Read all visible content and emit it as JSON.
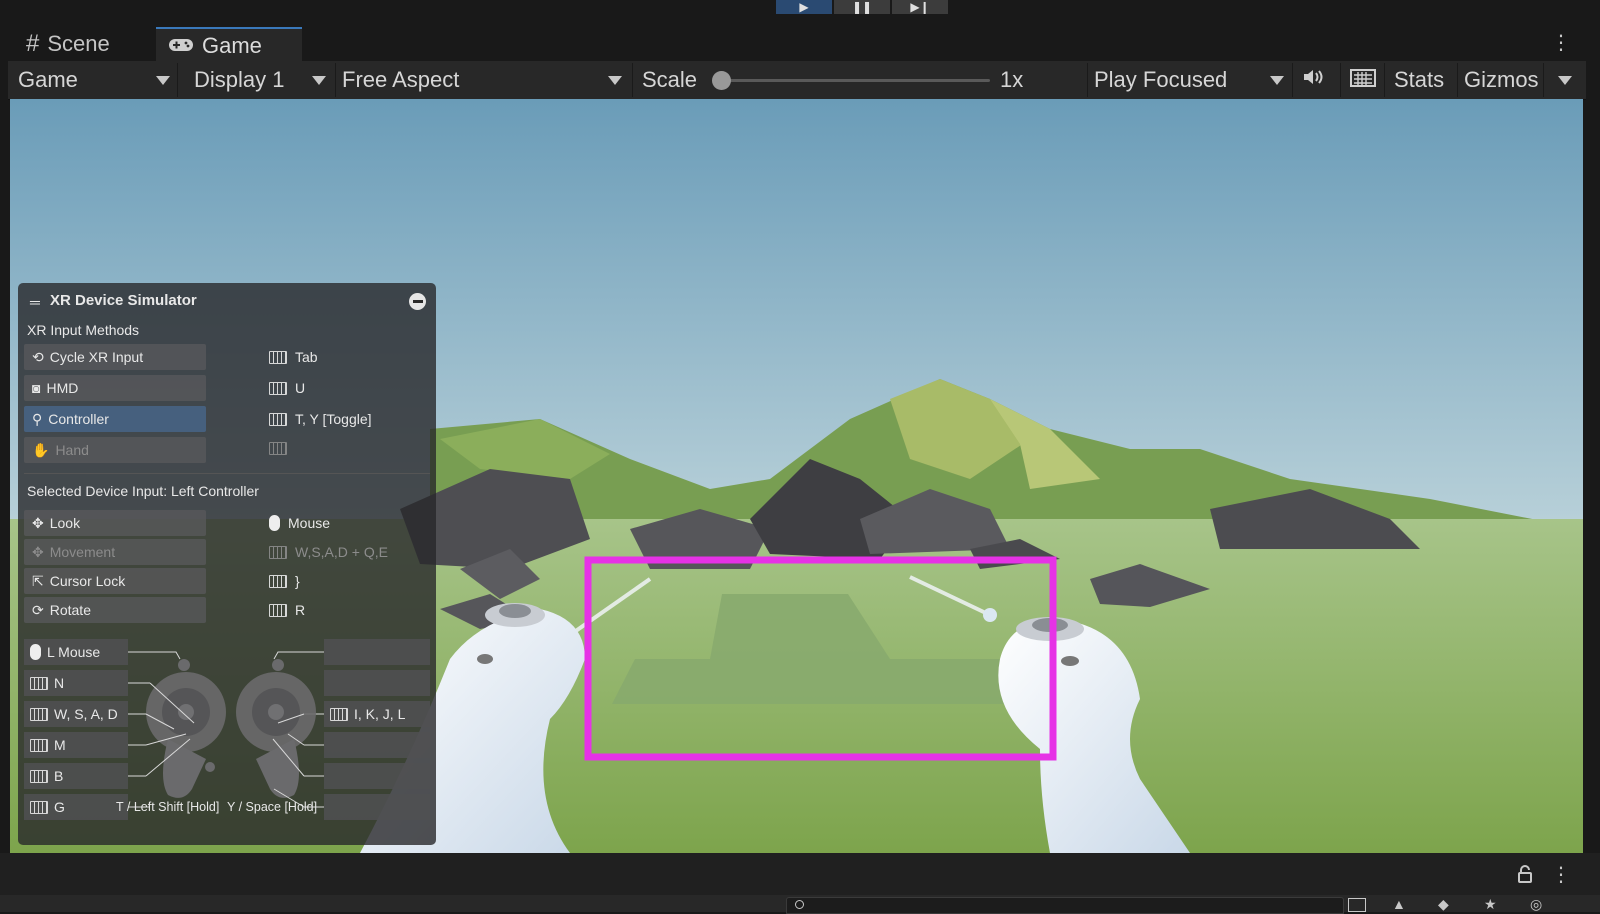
{
  "playbar": {
    "play_icon": "play-icon",
    "pause_icon": "pause-icon",
    "step_icon": "step-icon"
  },
  "tabs": [
    {
      "label": "Scene",
      "icon": "hash-icon"
    },
    {
      "label": "Game",
      "icon": "gamepad-icon"
    }
  ],
  "toolbar": {
    "view_select": "Game",
    "display_select": "Display 1",
    "aspect_select": "Free Aspect",
    "scale_label": "Scale",
    "scale_value": "1x",
    "scale_slider_level": 0,
    "play_mode_select": "Play Focused",
    "stats_label": "Stats",
    "gizmos_label": "Gizmos"
  },
  "simulator": {
    "title": "XR Device Simulator",
    "input_methods_heading": "XR Input Methods",
    "methods": [
      {
        "label": "Cycle XR Input",
        "key": "Tab",
        "icon": "cycle-icon"
      },
      {
        "label": "HMD",
        "key": "U",
        "icon": "headset-icon"
      },
      {
        "label": "Controller",
        "key": "T, Y [Toggle]",
        "icon": "controller-icon"
      },
      {
        "label": "Hand",
        "key": "",
        "icon": "hand-icon"
      }
    ],
    "selected_heading": "Selected Device Input: Left Controller",
    "device_inputs": [
      {
        "label": "Look",
        "key": "Mouse",
        "icon": "move-icon"
      },
      {
        "label": "Movement",
        "key": "W,S,A,D + Q,E",
        "icon": "move-icon"
      },
      {
        "label": "Cursor Lock",
        "key": "}",
        "icon": "cursor-icon"
      },
      {
        "label": "Rotate",
        "key": "R",
        "icon": "rotate-icon"
      }
    ],
    "left_keys": [
      "L Mouse",
      "N",
      "W, S, A, D",
      "M",
      "B",
      "G"
    ],
    "right_keys": [
      "",
      "",
      "I, K, J, L",
      "",
      "",
      ""
    ],
    "footer_left": "T / Left Shift [Hold]",
    "footer_right": "Y / Space [Hold]"
  },
  "colors": {
    "accent": "#3a79bb",
    "highlight_box": "#e632e6",
    "selected_button": "#46607e"
  }
}
